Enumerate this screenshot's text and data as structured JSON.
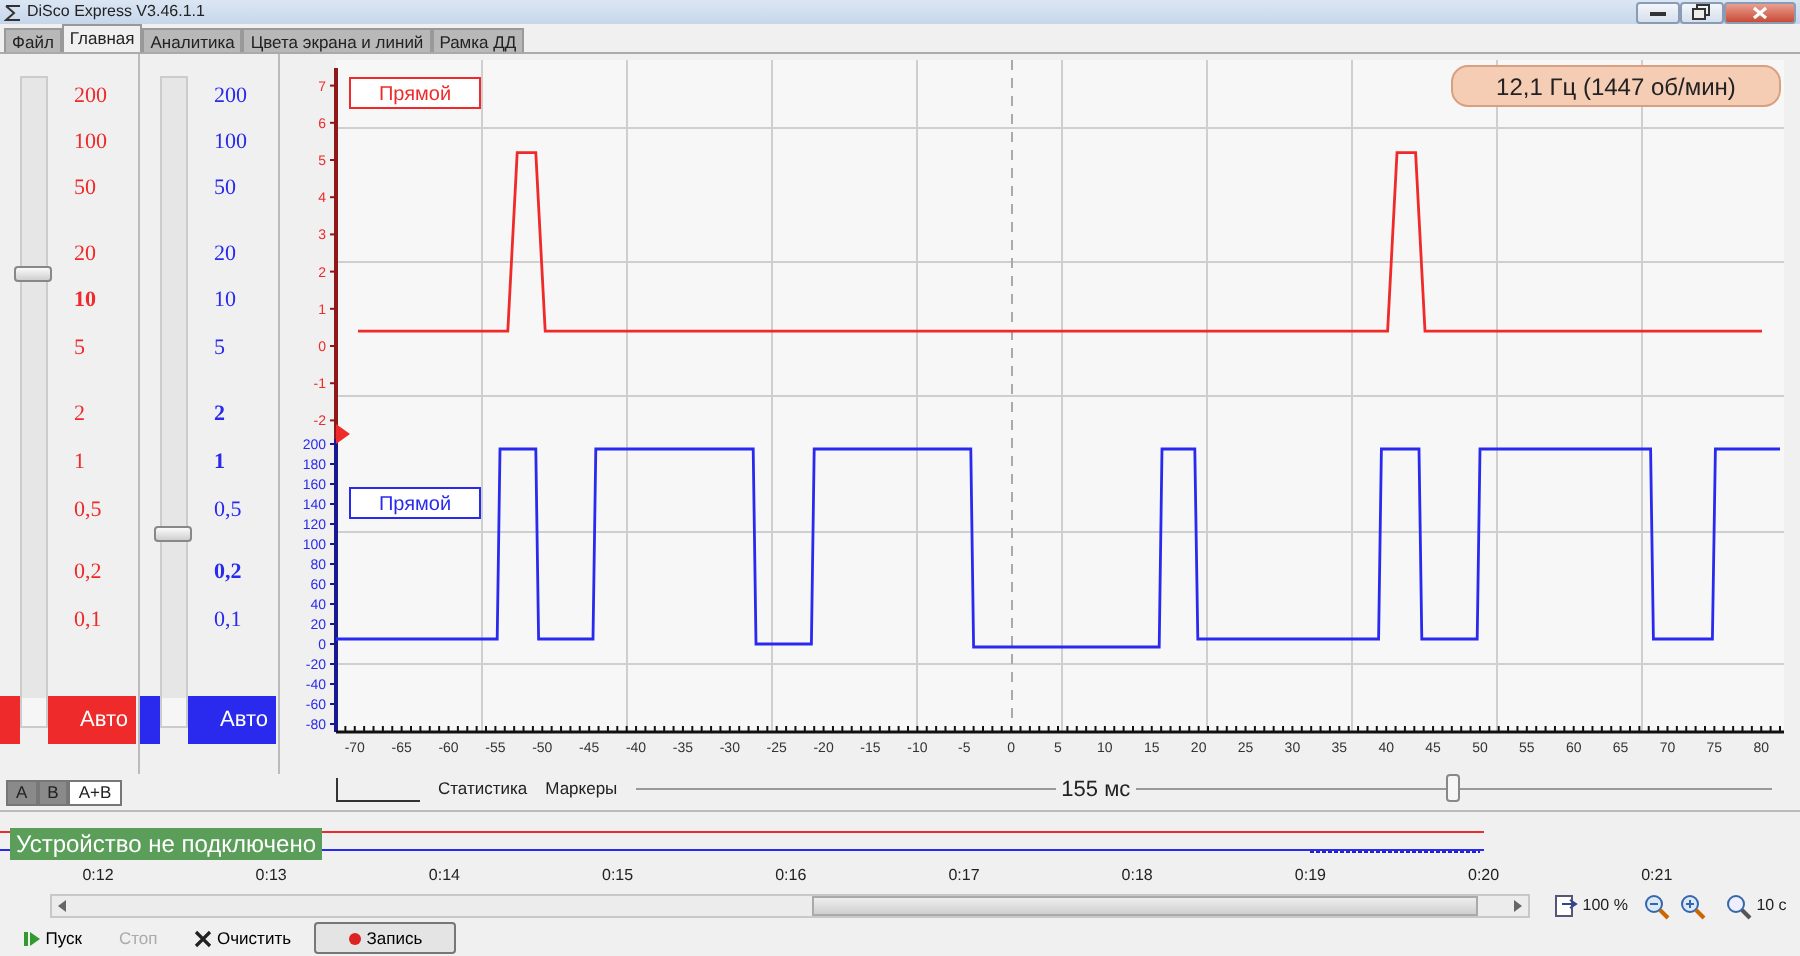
{
  "window": {
    "title": "DiSco Express V3.46.1.1"
  },
  "tabs": [
    {
      "label": "Файл",
      "selected": false
    },
    {
      "label": "Главная",
      "selected": true
    },
    {
      "label": "Аналитика",
      "selected": false
    },
    {
      "label": "Цвета экрана и линий",
      "selected": false
    },
    {
      "label": "Рамка ДД",
      "selected": false
    }
  ],
  "channels": [
    {
      "color": "#ee2a2a",
      "level": 0.68,
      "auto": "Авто",
      "scale": [
        {
          "label": "200",
          "bold": false
        },
        {
          "label": "100",
          "bold": false
        },
        {
          "label": "50",
          "bold": false
        },
        {
          "label": "20",
          "bold": false
        },
        {
          "label": "10",
          "bold": true
        },
        {
          "label": "5",
          "bold": false
        },
        {
          "label": "2",
          "bold": false
        },
        {
          "label": "1",
          "bold": false
        },
        {
          "label": "0,5",
          "bold": false
        },
        {
          "label": "0,2",
          "bold": false
        },
        {
          "label": "0,1",
          "bold": false
        }
      ],
      "chart_data": {
        "type": "line",
        "categories": [
          null,
          null,
          null,
          null,
          null,
          null,
          null,
          null,
          null,
          null,
          null,
          null,
          null,
          null,
          null,
          null,
          null,
          null,
          null,
          null,
          null,
          null,
          null,
          null,
          null,
          null,
          null,
          null,
          null,
          null,
          null,
          null,
          null,
          null,
          null,
          null,
          null,
          null,
          null,
          null,
          null,
          null,
          null,
          null,
          null,
          null,
          null,
          null,
          null,
          null,
          null,
          null,
          null,
          null,
          null,
          null,
          null,
          null,
          null,
          null,
          null,
          null,
          null,
          null,
          null,
          null,
          null,
          null,
          null,
          null,
          null,
          null,
          null,
          null,
          null,
          null,
          null,
          null,
          null,
          null,
          null,
          null,
          null,
          null,
          null,
          null,
          null,
          null,
          null,
          null,
          null,
          null,
          null,
          null,
          null,
          null,
          null,
          null,
          null,
          null,
          null,
          null,
          null,
          null,
          null,
          null,
          null,
          null,
          null,
          null,
          null,
          null,
          null,
          null,
          null,
          null,
          null,
          null,
          null,
          null,
          null,
          null,
          null,
          null,
          null,
          null,
          null,
          null,
          null,
          null,
          null,
          null,
          null,
          null,
          null,
          null,
          null,
          null,
          null,
          null,
          null,
          null,
          null,
          null,
          null,
          null,
          null,
          null,
          null,
          null,
          null
        ],
        "series": [
          {
            "name": "Прямой",
            "color": "#ee2a2a",
            "values": [
              0.4,
              0.4,
              0.4,
              0.4,
              0.4,
              0.4,
              0.4,
              0.4,
              0.4,
              0.4,
              0.4,
              0.4,
              0.4,
              0.4,
              0.4,
              0.4,
              0.4,
              5.2,
              5.2,
              5.2,
              0.4,
              0.4,
              0.4,
              0.4,
              0.4,
              0.4,
              0.4,
              0.4,
              0.4,
              0.4,
              0.4,
              0.4,
              0.4,
              0.4,
              0.4,
              0.4,
              0.4,
              0.4,
              0.4,
              0.4,
              0.4,
              0.4,
              0.4,
              0.4,
              0.4,
              0.4,
              0.4,
              0.4,
              0.4,
              0.4,
              0.4,
              0.4,
              0.4,
              0.4,
              0.4,
              0.4,
              0.4,
              0.4,
              0.4,
              0.4,
              0.4,
              0.4,
              0.4,
              0.4,
              0.4,
              0.4,
              0.4,
              0.4,
              0.4,
              0.4,
              0.4,
              0.4,
              0.4,
              0.4,
              0.4,
              0.4,
              0.4,
              0.4,
              0.4,
              0.4,
              0.4,
              0.4,
              0.4,
              0.4,
              0.4,
              0.4,
              0.4,
              0.4,
              0.4,
              0.4,
              0.4,
              0.4,
              0.4,
              0.4,
              0.4,
              0.4,
              0.4,
              0.4,
              0.4,
              0.4,
              0.4,
              0.4,
              0.4,
              0.4,
              0.4,
              0.4,
              0.4,
              0.4,
              0.4,
              0.4,
              0.4,
              5.2,
              5.2,
              5.2,
              0.4,
              0.4,
              0.4,
              0.4,
              0.4,
              0.4,
              0.4,
              0.4,
              0.4,
              0.4,
              0.4,
              0.4,
              0.4,
              0.4,
              0.4,
              0.4,
              0.4,
              0.4,
              0.4,
              0.4,
              0.4,
              0.4,
              0.4,
              0.4,
              0.4,
              0.4,
              0.4,
              0.4,
              0.4,
              0.4,
              0.4,
              0.4,
              0.4,
              0.4,
              0.4,
              0.4,
              0.4
            ]
          }
        ],
        "ylim": [
          -2.5,
          7.5
        ],
        "yticks": [
          7,
          6,
          5,
          4,
          3,
          2,
          1,
          0,
          -1,
          -2
        ]
      }
    },
    {
      "color": "#2a2aee",
      "level": 0.26,
      "auto": "Авто",
      "scale": [
        {
          "label": "200",
          "bold": false
        },
        {
          "label": "100",
          "bold": false
        },
        {
          "label": "50",
          "bold": false
        },
        {
          "label": "20",
          "bold": false
        },
        {
          "label": "10",
          "bold": false
        },
        {
          "label": "5",
          "bold": false
        },
        {
          "label": "2",
          "bold": true
        },
        {
          "label": "1",
          "bold": true
        },
        {
          "label": "0,5",
          "bold": false
        },
        {
          "label": "0,2",
          "bold": true
        },
        {
          "label": "0,1",
          "bold": false
        }
      ],
      "chart_data": {
        "type": "line",
        "x": [
          -72,
          -54.8,
          -54.5,
          -50.7,
          -50.4,
          -44.6,
          -44.3,
          -27.5,
          -27.2,
          -21.3,
          -21,
          -4.3,
          -4,
          15.8,
          16.1,
          19.6,
          19.9,
          39.2,
          39.5,
          43.5,
          43.8,
          49.7,
          50,
          68.2,
          68.5,
          74.8,
          75.1,
          82
        ],
        "series": [
          {
            "name": "Прямой",
            "color": "#2a2aee",
            "values": [
              5,
              5,
              195,
              195,
              5,
              5,
              195,
              195,
              0,
              0,
              195,
              195,
              -3,
              -3,
              195,
              195,
              5,
              5,
              195,
              195,
              5,
              5,
              195,
              195,
              5,
              5,
              195,
              195
            ]
          }
        ],
        "xlim": [
          -72,
          82
        ],
        "ylim": [
          -85,
          205
        ],
        "xticks": [
          -70,
          -65,
          -60,
          -55,
          -50,
          -45,
          -40,
          -35,
          -30,
          -25,
          -20,
          -15,
          -10,
          -5,
          0,
          5,
          10,
          15,
          20,
          25,
          30,
          35,
          40,
          45,
          50,
          55,
          60,
          65,
          70,
          75,
          80
        ],
        "yticks": [
          200,
          180,
          160,
          140,
          120,
          100,
          80,
          60,
          40,
          20,
          0,
          -20,
          -40,
          -60,
          -80
        ]
      }
    }
  ],
  "channel_tabs": [
    {
      "label": "A",
      "selected": false
    },
    {
      "label": "B",
      "selected": false
    },
    {
      "label": "A+B",
      "selected": true
    }
  ],
  "frequency": "12,1 Гц (1447 об/мин)",
  "panel_tabs": [
    "Статистика",
    "Маркеры"
  ],
  "time_window": {
    "label": "155 мс",
    "level": 0.72
  },
  "status": "Устройство не подключено",
  "timeline_ticks": [
    "0:12",
    "0:13",
    "0:14",
    "0:15",
    "0:16",
    "0:17",
    "0:18",
    "0:19",
    "0:20",
    "0:21"
  ],
  "zoom": {
    "percent": "100 %",
    "span": "10 с"
  },
  "toolbar": [
    {
      "kind": "play",
      "label": "Пуск",
      "disabled": false
    },
    {
      "kind": "stop",
      "label": "Стоп",
      "disabled": true
    },
    {
      "kind": "clear",
      "label": "Очистить",
      "disabled": false
    },
    {
      "kind": "record",
      "label": "Запись",
      "disabled": false
    }
  ]
}
